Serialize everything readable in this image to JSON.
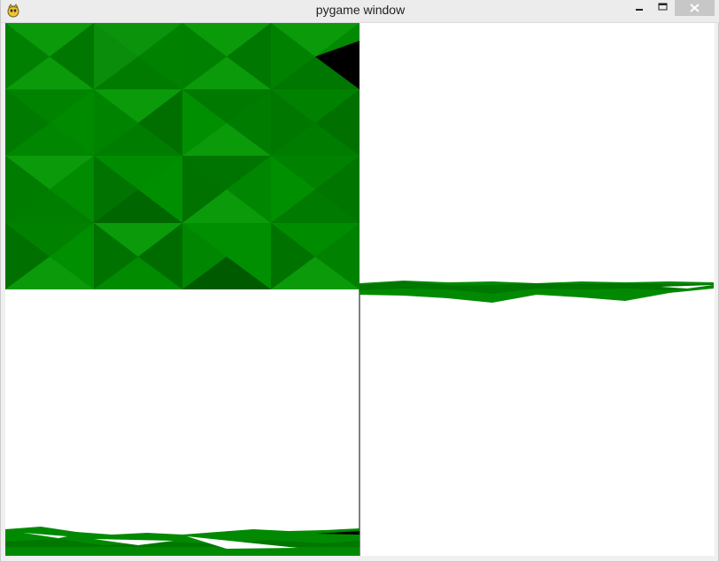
{
  "window": {
    "title": "pygame window"
  },
  "icons": {
    "app": "pygame-icon",
    "minimize": "minimize-icon",
    "maximize": "maximize-icon",
    "close": "close-icon"
  },
  "colors": {
    "green_light": "#0a9a0a",
    "green_mid": "#018a01",
    "green_dark": "#007700",
    "green_darker": "#006400",
    "black_patch": "#000000"
  }
}
